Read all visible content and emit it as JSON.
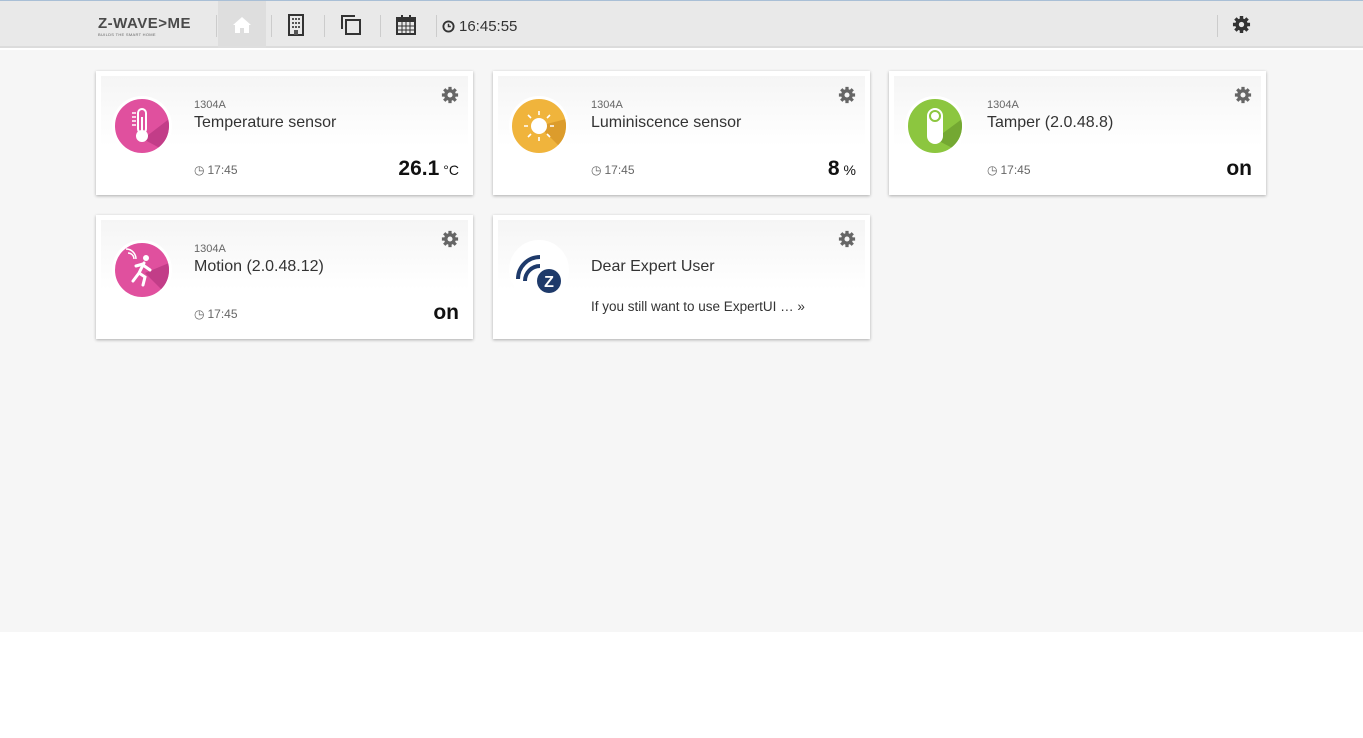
{
  "header": {
    "logo": "Z-WAVE>ME",
    "logo_tagline": "BUILDS THE SMART HOME",
    "clock": "16:45:55"
  },
  "cards": [
    {
      "id": "1304A",
      "title": "Temperature sensor",
      "time": "17:45",
      "value": "26.1",
      "unit": "°C",
      "color": "#e0509e"
    },
    {
      "id": "1304A",
      "title": "Luminiscence sensor",
      "time": "17:45",
      "value": "8",
      "unit": "%",
      "color": "#f0b43c"
    },
    {
      "id": "1304A",
      "title": "Tamper (2.0.48.8)",
      "time": "17:45",
      "value": "on",
      "unit": "",
      "color": "#8cc63f"
    },
    {
      "id": "1304A",
      "title": "Motion (2.0.48.12)",
      "time": "17:45",
      "value": "on",
      "unit": "",
      "color": "#e0509e"
    }
  ],
  "notice": {
    "title": "Dear Expert User",
    "message": "If you still want to use ExpertUI … »"
  }
}
